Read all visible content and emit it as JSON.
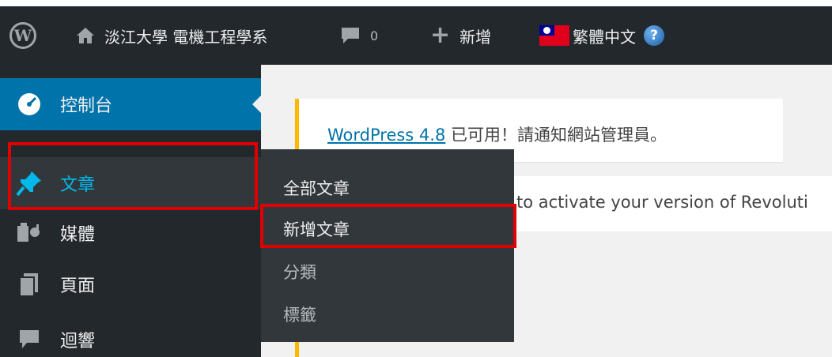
{
  "adminbar": {
    "site_name": "淡江大學 電機工程學系",
    "comments_count": "0",
    "new_label": "新增",
    "language": "繁體中文"
  },
  "sidebar": {
    "items": [
      {
        "label": "控制台",
        "icon": "dashboard-icon"
      },
      {
        "label": "文章",
        "icon": "pin-icon"
      },
      {
        "label": "媒體",
        "icon": "media-icon"
      },
      {
        "label": "頁面",
        "icon": "pages-icon"
      },
      {
        "label": "迴響",
        "icon": "comment-icon"
      }
    ]
  },
  "submenu": {
    "items": [
      "全部文章",
      "新增文章",
      "分類",
      "標籤"
    ]
  },
  "notice": {
    "link_text": "WordPress 4.8",
    "message": " 已可用！請通知網站管理員。"
  },
  "revo_notice": {
    "text": "to activate your version of Revoluti"
  },
  "colors": {
    "admin_bg": "#23282d",
    "active_blue": "#0073aa",
    "highlight_red": "#e00000",
    "notice_yellow": "#ffb900"
  }
}
